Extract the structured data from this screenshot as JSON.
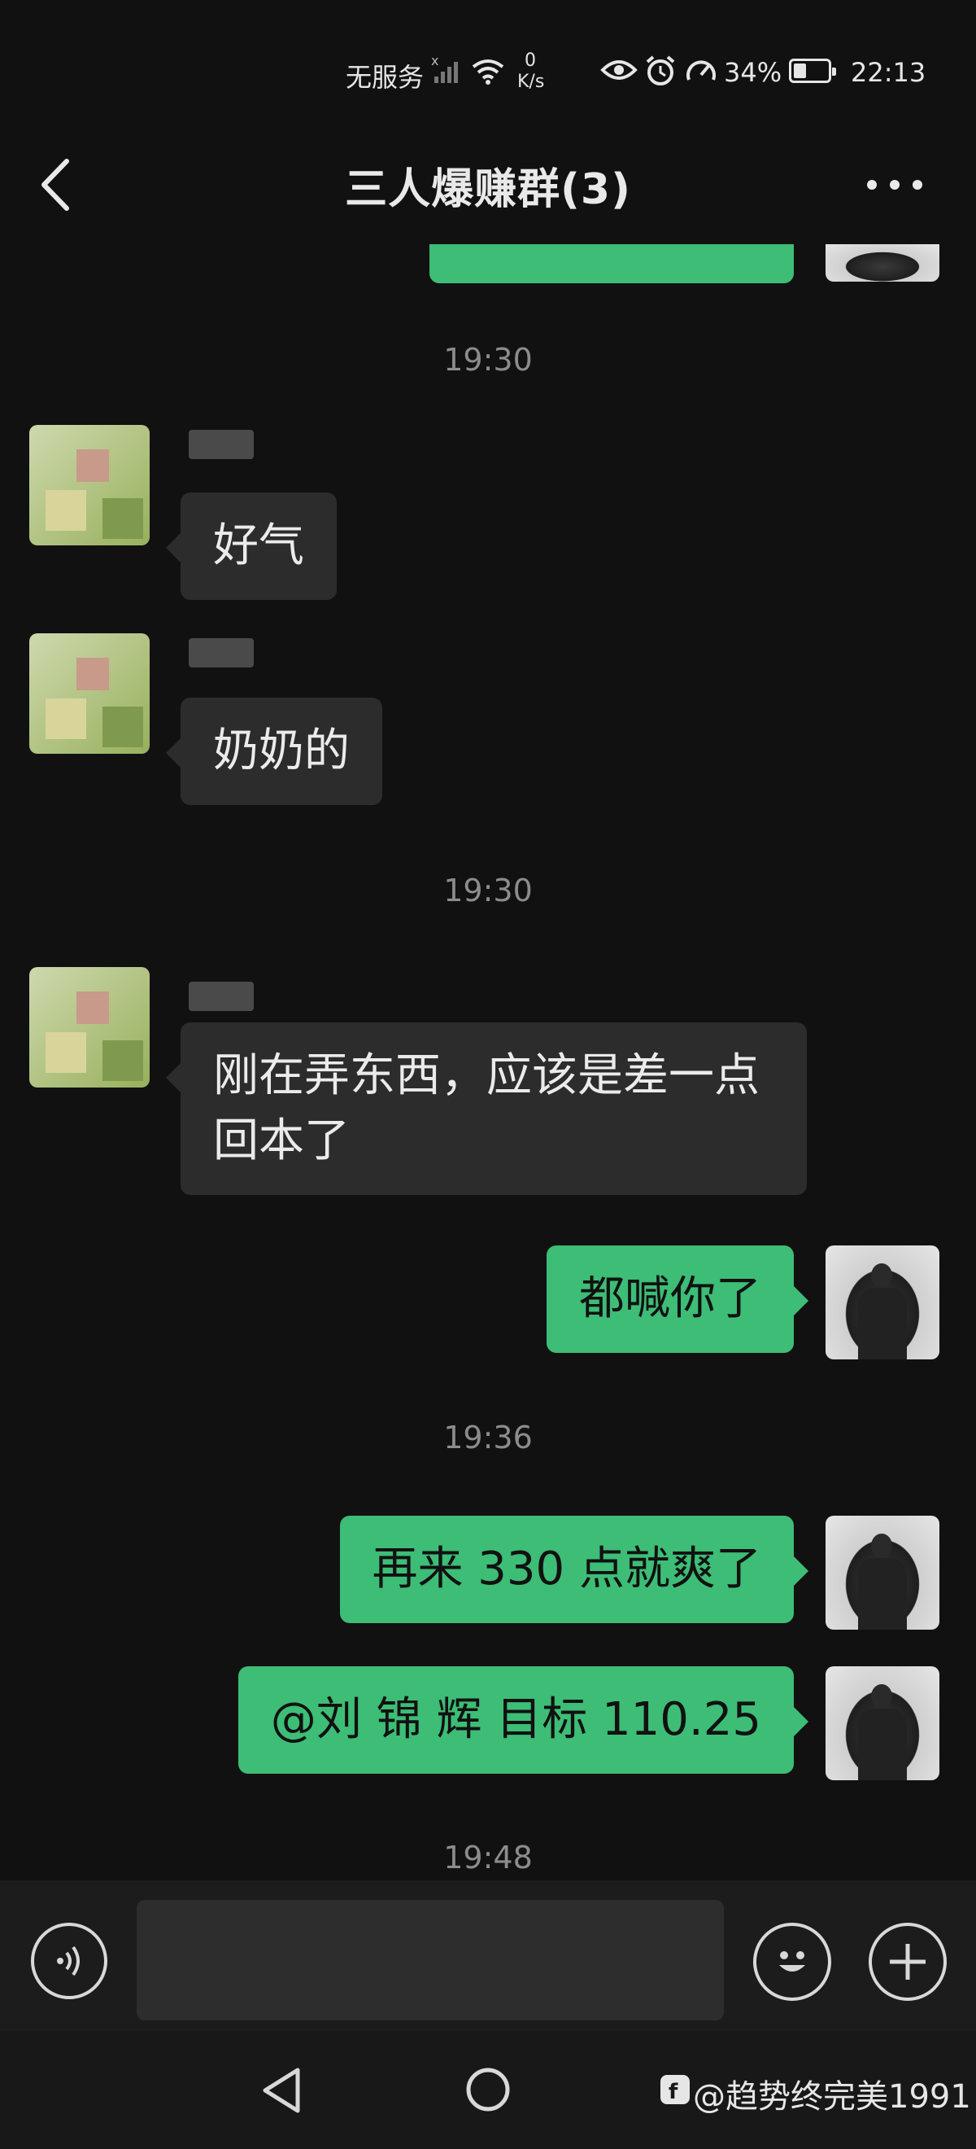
{
  "status_bar": {
    "carrier": "无服务",
    "net_speed_value": "0",
    "net_speed_unit": "K/s",
    "battery_pct": "34%",
    "time": "22:13",
    "battery_level": 0.34
  },
  "header": {
    "title": "三人爆赚群(3)"
  },
  "messages": {
    "time1": "19:30",
    "m1": "好气",
    "m2": "奶奶的",
    "time2": "19:30",
    "m3_line1": "刚在弄东西，应该是差一点",
    "m3_line2": "回本了",
    "m4": "都喊你了",
    "time3": "19:36",
    "m5": "再来 330 点就爽了",
    "m6": "@刘 锦 辉  目标 110.25",
    "time4": "19:48"
  },
  "input": {
    "placeholder": ""
  },
  "watermark": {
    "text": "@趋势终完美1991"
  },
  "colors": {
    "background": "#111111",
    "outgoing_bubble": "#3dbd76",
    "incoming_bubble": "#2c2c2c"
  }
}
